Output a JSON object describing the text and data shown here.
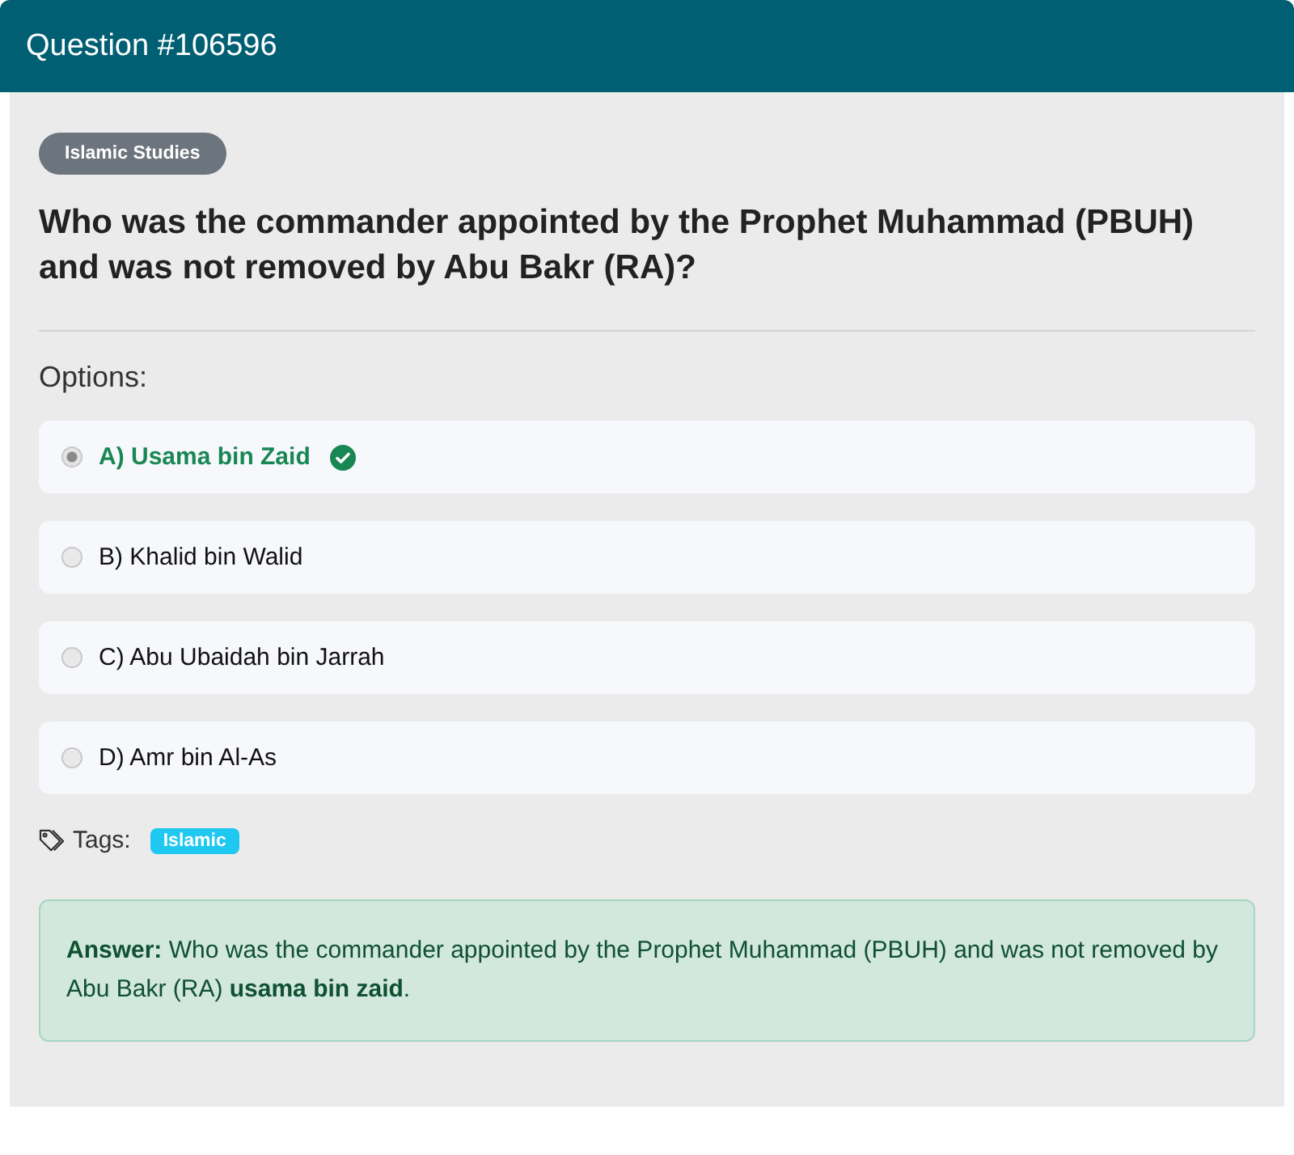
{
  "header": {
    "title": "Question #106596"
  },
  "category": "Islamic Studies",
  "question": "Who was the commander appointed by the Prophet Muhammad (PBUH) and was not removed by Abu Bakr (RA)?",
  "options_label": "Options:",
  "options": [
    {
      "label": "A) Usama bin Zaid",
      "selected": true,
      "correct": true
    },
    {
      "label": "B) Khalid bin Walid",
      "selected": false,
      "correct": false
    },
    {
      "label": "C) Abu Ubaidah bin Jarrah",
      "selected": false,
      "correct": false
    },
    {
      "label": "D) Amr bin Al-As",
      "selected": false,
      "correct": false
    }
  ],
  "tags_label": "Tags:",
  "tags": [
    "Islamic"
  ],
  "answer": "**Answer:** Who was the commander appointed by the Prophet Muhammad (PBUH) and was not removed by Abu Bakr (RA) **usama bin zaid**."
}
